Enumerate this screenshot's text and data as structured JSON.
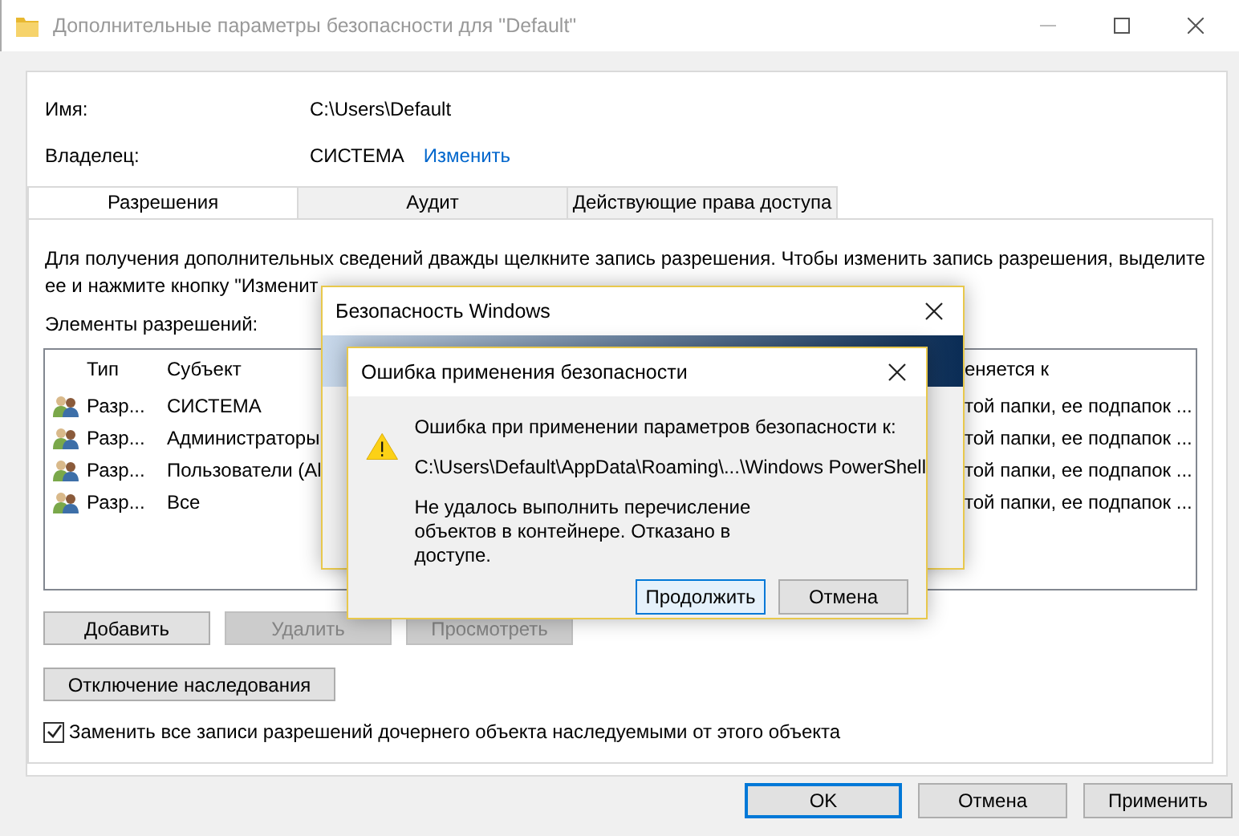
{
  "window": {
    "title": "Дополнительные параметры безопасности  для \"Default\""
  },
  "fields": [
    {
      "label": "Имя:",
      "value": "C:\\Users\\Default"
    },
    {
      "label": "Владелец:",
      "value": "СИСТЕМА",
      "link": "Изменить"
    }
  ],
  "tabs": [
    {
      "label": "Разрешения",
      "selected": true
    },
    {
      "label": "Аудит",
      "selected": false
    },
    {
      "label": "Действующие права доступа",
      "selected": false
    }
  ],
  "description": [
    "Для получения дополнительных сведений дважды щелкните запись разрешения. Чтобы изменить запись разрешения, выделите",
    "ее и нажмите кнопку \"Изменит"
  ],
  "entries_label": "Элементы разрешений:",
  "table": {
    "columns": [
      "Тип",
      "Субъект",
      "еняется к"
    ],
    "rows": [
      {
        "type": "Разр...",
        "subject": "СИСТЕМА",
        "applies_to": "той папки, ее подпапок ..."
      },
      {
        "type": "Разр...",
        "subject": "Администраторы",
        "applies_to": "той папки, ее подпапок ..."
      },
      {
        "type": "Разр...",
        "subject": "Пользователи (Al",
        "applies_to": "той папки, ее подпапок ..."
      },
      {
        "type": "Разр...",
        "subject": "Все",
        "applies_to": "той папки, ее подпапок ..."
      }
    ]
  },
  "buttons": [
    {
      "label": "Добавить",
      "disabled": false
    },
    {
      "label": "Удалить",
      "disabled": true
    },
    {
      "label": "Просмотреть",
      "disabled": true
    }
  ],
  "inheritance_button": "Отключение наследования",
  "replace_checkbox": {
    "label": "Заменить все записи разрешений дочернего объекта наследуемыми от этого объекта",
    "checked": true
  },
  "footer_buttons": [
    {
      "label": "OK",
      "selected": true
    },
    {
      "label": "Отмена",
      "selected": false
    },
    {
      "label": "Применить",
      "selected": false
    }
  ],
  "security_dialog": {
    "title": "Безопасность Windows"
  },
  "error_dialog": {
    "title": "Ошибка применения безопасности",
    "message": "Ошибка при применении параметров безопасности к:",
    "path": "C:\\Users\\Default\\AppData\\Roaming\\...\\Windows PowerShell",
    "detail": "Не удалось выполнить перечисление объектов в контейнере. Отказано в доступе.",
    "buttons": [
      {
        "label": "Продолжить",
        "selected": true
      },
      {
        "label": "Отмена",
        "selected": false
      }
    ]
  }
}
